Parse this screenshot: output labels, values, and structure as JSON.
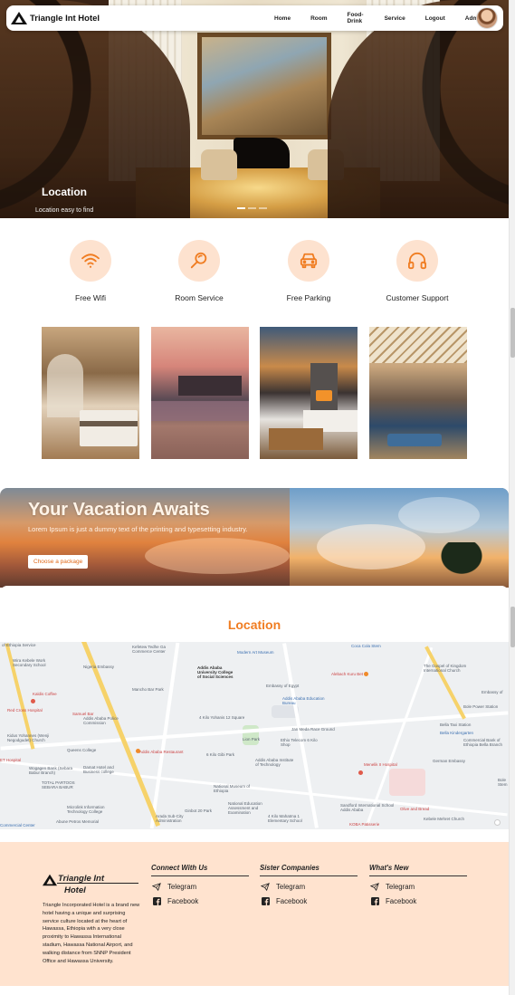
{
  "navbar": {
    "brand": "Triangle Int Hotel",
    "links": [
      "Home",
      "Room",
      "Food-Drink",
      "Service",
      "Logout",
      "Admin"
    ]
  },
  "hero": {
    "caption": "Location",
    "subcaption": "Location easy to find",
    "slides": 3,
    "active_slide": 1
  },
  "features": [
    {
      "label": "Free Wifi",
      "icon": "wifi-icon"
    },
    {
      "label": "Room Service",
      "icon": "room-service-icon"
    },
    {
      "label": "Free Parking",
      "icon": "car-icon"
    },
    {
      "label": "Customer Support",
      "icon": "headphones-icon"
    }
  ],
  "vacation": {
    "title": "Your Vacation Awaits",
    "subtitle": "Lorem Ipsum is just a dummy text of the printing and typesetting industry.",
    "button": "Choose a package"
  },
  "location": {
    "title": "Location"
  },
  "map": {
    "labels": [
      "of Ethiopia Service",
      "Kefetew Tedhe Ga Commerce Center",
      "Modern Art Museum",
      "Coca Cola Stem",
      "Wira Kebele Work Secondary School",
      "Nigeria Embassy",
      "Addis Ababa University College of Social Sciences",
      "The Gospel of Kingdom International Church",
      "Kaldis Coffee",
      "Mancho Bar Park",
      "Embassy of Egypt",
      "Addis Ababa Education Bureau",
      "Alebach Kuru Bet",
      "Embassy of",
      "Bole Power Station",
      "Red Cross Hospital",
      "Samuel Bar",
      "Addis Ababa Police Commission",
      "4 Kilo Yohanis 12 Square",
      "Jan Meda Race Ground",
      "Bella Taxi Station",
      "Bella Kindergarten",
      "Kidus Yohannes (Wenji Negodgudet) Church",
      "Queens College",
      "Addis Ababa Restaurant",
      "Lion Park",
      "Ethio Telecom 6 Kilo Shop",
      "Commercial Bank of Ethiopia Bella Branch",
      "ET Hospital",
      "Wogagen Bank (Sebara Babur Branch)",
      "Damat Hotel and Business college",
      "6 Kilo Gibi Park",
      "Addis Ababa Institute of Technology",
      "German Embassy",
      "TOTAL PARTOOS SEBARA BABUR",
      "National Museum of Ethiopia",
      "Menelik II Hospital",
      "Microlink Information Technology College",
      "Arada Sub-City Administration",
      "National Education Assessment and Examination",
      "Sandford International School Addis Ababa",
      "Abune Petros Memorial",
      "Ginbot 20 Park",
      "4 Kilo Mahatma 1 Elementary School",
      "Olive and Bread",
      "Kebele Mehret Church",
      "Commercial Center",
      "KOBA Patisserie",
      "Bole Stem"
    ]
  },
  "footer": {
    "brand": "Triangle Int Hotel",
    "brand_line1": "Triangle Int",
    "brand_line2": "Hotel",
    "about": "Triangle Incorporated Hotel is a brand new hotel having a unique and surprising service culture located at the heart of Hawassa, Ethiopia with a very close proximity to Hawassa International stadium, Hawassa National Airport, and walking distance from SNNP President Office and Hawassa University.",
    "columns": [
      {
        "heading": "Connect With Us",
        "links": [
          "Telegram",
          "Facebook"
        ]
      },
      {
        "heading": "Sister Companies",
        "links": [
          "Telegram",
          "Facebook"
        ]
      },
      {
        "heading": "What's New",
        "links": [
          "Telegram",
          "Facebook"
        ]
      }
    ]
  },
  "colors": {
    "accent": "#f07d22",
    "feature_circle": "#fde2cf",
    "footer_bg": "#ffe3cf"
  }
}
